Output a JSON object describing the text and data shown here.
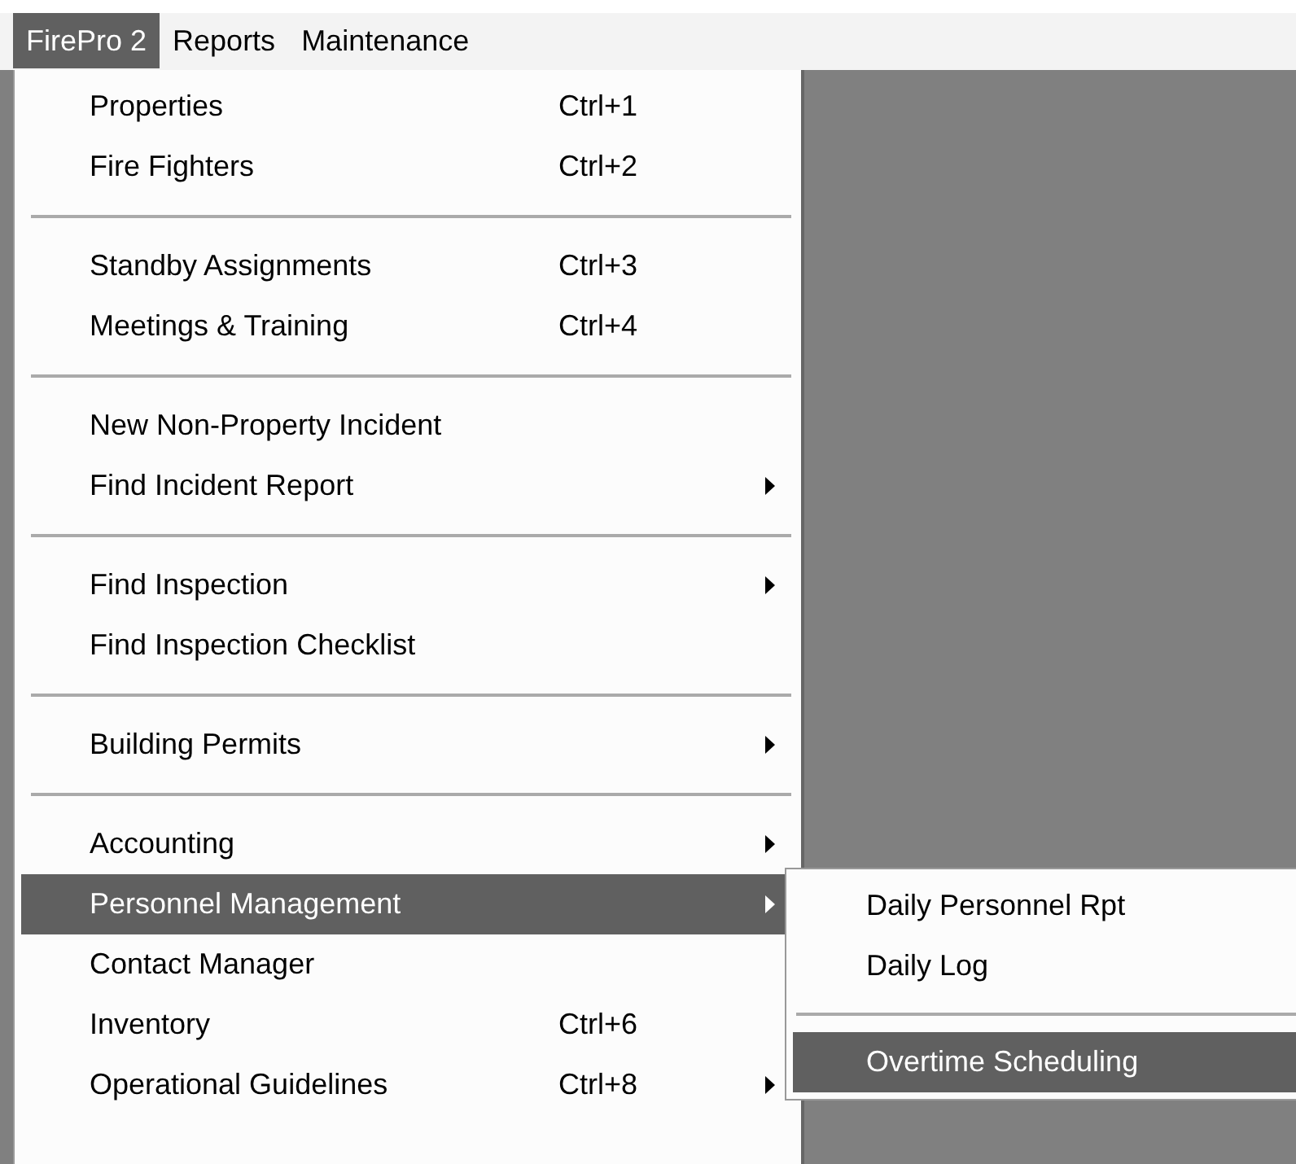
{
  "menubar": [
    {
      "label": "FirePro 2",
      "selected": true
    },
    {
      "label": "Reports",
      "selected": false
    },
    {
      "label": "Maintenance",
      "selected": false
    }
  ],
  "menu": [
    {
      "kind": "item",
      "label": "Properties",
      "shortcut": "Ctrl+1",
      "arrow": false,
      "selected": false
    },
    {
      "kind": "item",
      "label": "Fire Fighters",
      "shortcut": "Ctrl+2",
      "arrow": false,
      "selected": false
    },
    {
      "kind": "separator"
    },
    {
      "kind": "item",
      "label": "Standby Assignments",
      "shortcut": "Ctrl+3",
      "arrow": false,
      "selected": false
    },
    {
      "kind": "item",
      "label": "Meetings & Training",
      "shortcut": "Ctrl+4",
      "arrow": false,
      "selected": false
    },
    {
      "kind": "separator"
    },
    {
      "kind": "item",
      "label": "New Non-Property Incident",
      "arrow": false,
      "selected": false
    },
    {
      "kind": "item",
      "label": "Find Incident Report",
      "arrow": true,
      "selected": false
    },
    {
      "kind": "separator"
    },
    {
      "kind": "item",
      "label": "Find Inspection",
      "arrow": true,
      "selected": false
    },
    {
      "kind": "item",
      "label": "Find Inspection Checklist",
      "arrow": false,
      "selected": false
    },
    {
      "kind": "separator"
    },
    {
      "kind": "item",
      "label": "Building Permits",
      "arrow": true,
      "selected": false
    },
    {
      "kind": "separator"
    },
    {
      "kind": "item",
      "label": "Accounting",
      "arrow": true,
      "selected": false
    },
    {
      "kind": "item",
      "label": "Personnel Management",
      "arrow": true,
      "selected": true,
      "children": [
        {
          "kind": "item",
          "label": "Daily Personnel Rpt",
          "selected": false
        },
        {
          "kind": "item",
          "label": "Daily Log",
          "selected": false
        },
        {
          "kind": "separator"
        },
        {
          "kind": "item",
          "label": "Overtime Scheduling",
          "selected": true
        }
      ]
    },
    {
      "kind": "item",
      "label": "Contact Manager",
      "arrow": false,
      "selected": false
    },
    {
      "kind": "item",
      "label": "Inventory",
      "shortcut": "Ctrl+6",
      "arrow": false,
      "selected": false
    },
    {
      "kind": "item",
      "label": "Operational Guidelines",
      "shortcut": "Ctrl+8",
      "arrow": true,
      "selected": false
    }
  ]
}
